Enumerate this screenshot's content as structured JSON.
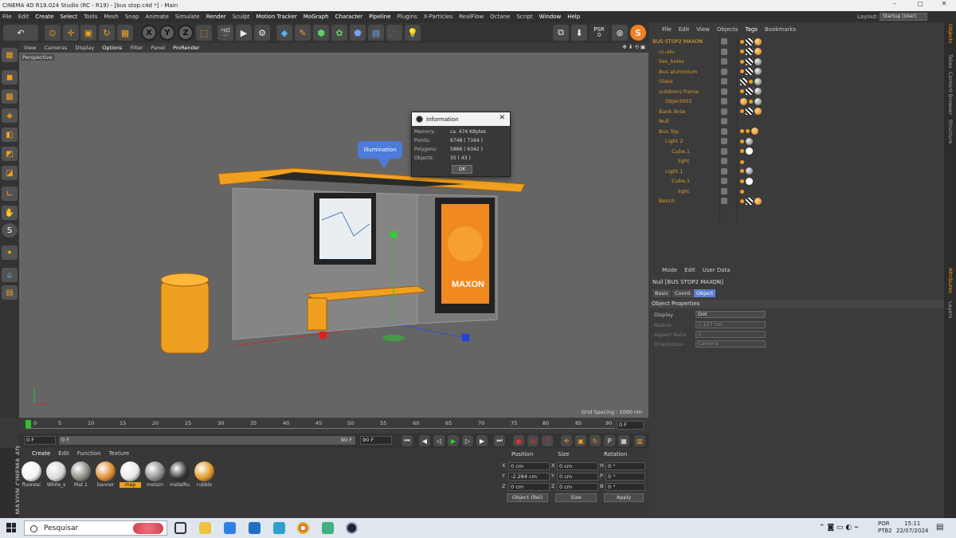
{
  "window": {
    "title": "CINEMA 4D R19.024 Studio (RC - R19) - [bus stop.c4d *] - Main"
  },
  "menubar": {
    "items": [
      "File",
      "Edit",
      "Create",
      "Select",
      "Tools",
      "Mesh",
      "Snap",
      "Animate",
      "Simulate",
      "Render",
      "Sculpt",
      "Motion Tracker",
      "MoGraph",
      "Character",
      "Pipeline",
      "Plugins",
      "X-Particles",
      "RealFlow",
      "Octane",
      "Script",
      "Window",
      "Help"
    ],
    "layout_label": "Layout:",
    "layout_value": "Startup (User)"
  },
  "toolbar": {
    "psr_label": "PSR",
    "psr_value": "0"
  },
  "viewport": {
    "menu": [
      "View",
      "Cameras",
      "Display",
      "Options",
      "Filter",
      "Panel",
      "ProRender"
    ],
    "camera_label": "Perspective",
    "grid_spacing": "Grid Spacing : 1000 cm",
    "illumination_label": "Illumination"
  },
  "info_dialog": {
    "title": "Information",
    "rows": [
      {
        "k": "Memory:",
        "v": "ca. 474 KBytes"
      },
      {
        "k": "Points:",
        "v": "6748 ( 7164 )"
      },
      {
        "k": "Polygons:",
        "v": "5886 ( 6342 )"
      },
      {
        "k": "Objects:",
        "v": "35 ( 43 )"
      }
    ],
    "ok_label": "OK"
  },
  "timeline": {
    "ticks": [
      "0",
      "5",
      "10",
      "15",
      "20",
      "25",
      "30",
      "35",
      "40",
      "45",
      "50",
      "55",
      "60",
      "65",
      "70",
      "75",
      "80",
      "85",
      "90"
    ],
    "end_field": "0 F"
  },
  "transport": {
    "current_frame": "0 F",
    "start_frame": "0 F",
    "range_end": "90 F",
    "end_frame": "90 F"
  },
  "material_manager": {
    "menu": [
      "Create",
      "Edit",
      "Function",
      "Texture"
    ],
    "materials": [
      {
        "name": "fluoresc",
        "color": "#f4f4f4"
      },
      {
        "name": "White_s",
        "color": "#d8d8d8"
      },
      {
        "name": "Mat.1",
        "color": "#8a8a80"
      },
      {
        "name": "banner",
        "color": "#e08a30"
      },
      {
        "name": "map",
        "color": "#e8e8e8"
      },
      {
        "name": "metain",
        "color": "#8e8e8e"
      },
      {
        "name": "metalRu",
        "color": "#333333"
      },
      {
        "name": "rubble",
        "color": "#e09a25"
      }
    ],
    "selected": "map",
    "brand": "MAXON CINEMA 4D"
  },
  "coord_manager": {
    "headers": [
      "Position",
      "Size",
      "Rotation"
    ],
    "rows": [
      {
        "axis": "X",
        "pos": "0 cm",
        "saxis": "X",
        "size": "0 cm",
        "raxis": "H",
        "rot": "0 °"
      },
      {
        "axis": "Y",
        "pos": "-2.284 cm",
        "saxis": "Y",
        "size": "0 cm",
        "raxis": "P",
        "rot": "0 °"
      },
      {
        "axis": "Z",
        "pos": "0 cm",
        "saxis": "Z",
        "size": "0 cm",
        "raxis": "B",
        "rot": "0 °"
      }
    ],
    "mode": "Object (Rel)",
    "size_mode": "Size",
    "apply_label": "Apply"
  },
  "object_manager": {
    "menu": [
      "File",
      "Edit",
      "View",
      "Objects",
      "Tags",
      "Bookmarks"
    ],
    "objects": [
      {
        "name": "BUS STOP2 MAXON",
        "indent": 0
      },
      {
        "name": "cc-alu",
        "indent": 1
      },
      {
        "name": "lixo_bolos",
        "indent": 1
      },
      {
        "name": "Bus aluminium",
        "indent": 1
      },
      {
        "name": "Glass",
        "indent": 1
      },
      {
        "name": "outdoors frame",
        "indent": 1
      },
      {
        "name": "Object002",
        "indent": 2
      },
      {
        "name": "Bank Ante",
        "indent": 1
      },
      {
        "name": "Null",
        "indent": 1
      },
      {
        "name": "Bus Top",
        "indent": 1
      },
      {
        "name": "Light 2",
        "indent": 2
      },
      {
        "name": "Cube.1",
        "indent": 3
      },
      {
        "name": "light",
        "indent": 4
      },
      {
        "name": "Light 1",
        "indent": 2
      },
      {
        "name": "Cube.1",
        "indent": 3
      },
      {
        "name": "light",
        "indent": 4
      },
      {
        "name": "Bench",
        "indent": 1
      }
    ]
  },
  "attribute_manager": {
    "menu": [
      "Mode",
      "Edit",
      "User Data"
    ],
    "title": "Null [BUS STOP2 MAXON]",
    "tabs": [
      "Basic",
      "Coord.",
      "Object"
    ],
    "active_tab": "Object",
    "section": "Object Properties",
    "props": [
      {
        "label": "Display",
        "value": "Dot"
      },
      {
        "label": "Radius",
        "value": "1.127 cm"
      },
      {
        "label": "Aspect Ratio",
        "value": "1"
      },
      {
        "label": "Orientation",
        "value": "Camera"
      }
    ]
  },
  "right_strip": [
    "Objects",
    "Takes",
    "Content Browser",
    "Structure",
    "Attributes",
    "Layers"
  ],
  "taskbar": {
    "search_placeholder": "Pesquisar",
    "lang": "POR",
    "lang2": "PTB2",
    "time": "15:11",
    "date": "22/07/2024"
  }
}
